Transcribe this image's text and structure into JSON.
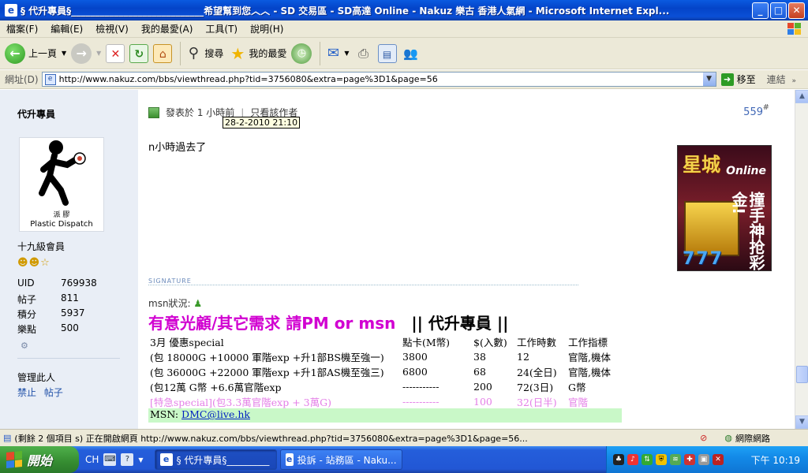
{
  "window": {
    "title": "§ 代升專員§____________________________希望幫到您︿︿ - SD 交易區 - SD高達 Online - Nakuz 樂古 香港人氣網 - Microsoft Internet Expl...",
    "buttons": {
      "minimize": "_",
      "maximize": "□",
      "close": "✕"
    }
  },
  "menu": [
    "檔案(F)",
    "編輯(E)",
    "檢視(V)",
    "我的最愛(A)",
    "工具(T)",
    "說明(H)"
  ],
  "toolbar": {
    "back_label": "上一頁",
    "search_label": "搜尋",
    "favorites_label": "我的最愛"
  },
  "address": {
    "label": "網址(D)",
    "url": "http://www.nakuz.com/bbs/viewthread.php?tid=3756080&extra=page%3D1&page=56",
    "go_label": "移至",
    "links_label": "連結"
  },
  "sidebar": {
    "author": "代升專員",
    "avatar_caption1": "派 膠",
    "avatar_caption2": "Plastic Dispatch",
    "rank": "十九級會員",
    "stats": [
      {
        "label": "UID",
        "value": "769938"
      },
      {
        "label": "帖子",
        "value": "811"
      },
      {
        "label": "積分",
        "value": "5937"
      },
      {
        "label": "樂點",
        "value": "500"
      }
    ],
    "manage_label": "管理此人",
    "link_ban": "禁止",
    "link_posts": "帖子"
  },
  "post": {
    "posted_at": "發表於 1 小時前",
    "only_author": "只看該作者",
    "tooltip": "28-2-2010 21:10",
    "floor": "559",
    "hash": "#",
    "body": "n小時過去了",
    "signature_label": "SIGNATURE",
    "msn_status": "msn狀況:",
    "big_left": "有意光顧/其它需求 請PM or msn",
    "big_right": "|| 代升專員 ||",
    "ad": {
      "title": "星城",
      "subtitle": "Online",
      "slogan": "撞手神抢彩金!",
      "sevens": "777"
    }
  },
  "price_table": {
    "header": [
      "3月 優惠special",
      "點卡(M幣)",
      "$(入數)",
      "工作時數",
      "工作指標"
    ],
    "rows": [
      [
        "(包 18000G +10000 軍階exp +升1部BS機至強一)",
        "3800",
        "38",
        "12",
        "官階,機体"
      ],
      [
        "(包 36000G +22000 軍階exp +升1部AS機至強三)",
        "6800",
        "68",
        "24(全日)",
        "官階,機体"
      ],
      [
        "(包12萬 G幣 +6.6萬官階exp",
        "-----------",
        "200",
        "72(3日)",
        "G幣"
      ],
      [
        "[特急special](包3.3萬官階exp + 3萬G)",
        "-----------",
        "100",
        "32(日半)",
        "官階"
      ]
    ],
    "msn_label": "MSN: ",
    "msn_link": "DMC@live.hk"
  },
  "status": {
    "text": "(剩餘 2 個項目 s) 正在開啟網頁 http://www.nakuz.com/bbs/viewthread.php?tid=3756080&extra=page%3D1&page=56...",
    "zone": "網際網路"
  },
  "taskbar": {
    "start": "開始",
    "lang": "CH",
    "tasks": [
      "§ 代升專員§_________",
      "投訴 - 站務區 - Naku..."
    ],
    "clock": "下午 10:19"
  }
}
